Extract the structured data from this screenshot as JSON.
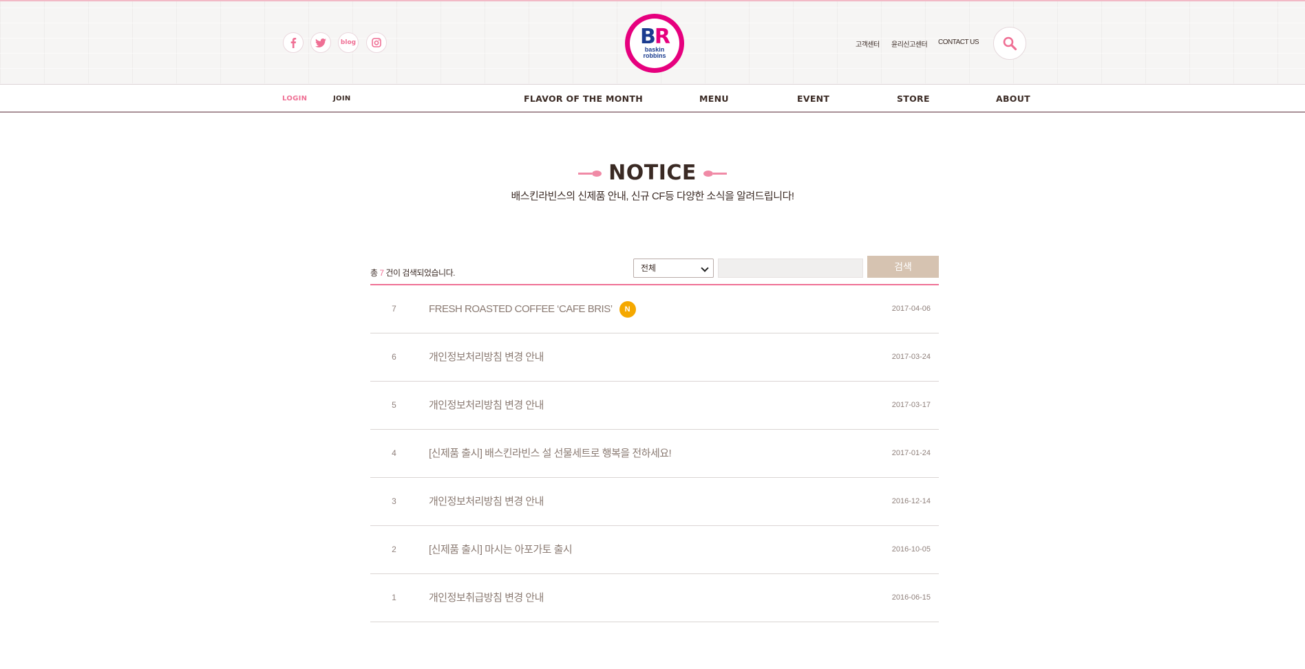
{
  "header": {
    "social": [
      {
        "name": "facebook-icon"
      },
      {
        "name": "twitter-icon"
      },
      {
        "name": "blog-icon",
        "label": "blog"
      },
      {
        "name": "instagram-icon"
      }
    ],
    "logo": {
      "mark_b": "B",
      "mark_r": "R",
      "line1": "baskin",
      "line2": "robbins"
    },
    "util_links": [
      "고객센터",
      "윤리신고센터",
      "CONTACT US"
    ],
    "search_icon": "search-icon"
  },
  "nav": {
    "login": "LOGIN",
    "join": "JOIN",
    "items": [
      "FLAVOR OF THE MONTH",
      "MENU",
      "EVENT",
      "STORE",
      "ABOUT"
    ]
  },
  "page": {
    "title": "NOTICE",
    "subtitle": "배스킨라빈스의 신제품 안내, 신규 CF등 다양한 소식을 알려드립니다!"
  },
  "search": {
    "count_prefix": "총",
    "count": "7",
    "count_suffix": "건이 검색되었습니다.",
    "select_value": "전체",
    "input_value": "",
    "button_label": "검색"
  },
  "notices": [
    {
      "num": "7",
      "title": "FRESH ROASTED COFFEE ‘CAFE BRIS’",
      "new_badge": "N",
      "date": "2017-04-06"
    },
    {
      "num": "6",
      "title": "개인정보처리방침 변경 안내",
      "date": "2017-03-24"
    },
    {
      "num": "5",
      "title": "개인정보처리방침 변경 안내",
      "date": "2017-03-17"
    },
    {
      "num": "4",
      "title": "[신제품 출시] 배스킨라빈스 설 선물세트로 행복을 전하세요!",
      "date": "2017-01-24"
    },
    {
      "num": "3",
      "title": "개인정보처리방침 변경 안내",
      "date": "2016-12-14"
    },
    {
      "num": "2",
      "title": "[신제품 출시] 마시는 아포가토 출시",
      "date": "2016-10-05"
    },
    {
      "num": "1",
      "title": "개인정보취급방침 변경 안내",
      "date": "2016-06-15"
    }
  ],
  "colors": {
    "accent": "#ef6f94",
    "brand_pink": "#e6007e",
    "brand_blue": "#1b3c8f",
    "button": "#d6c3b1",
    "badge": "#f5a800"
  }
}
